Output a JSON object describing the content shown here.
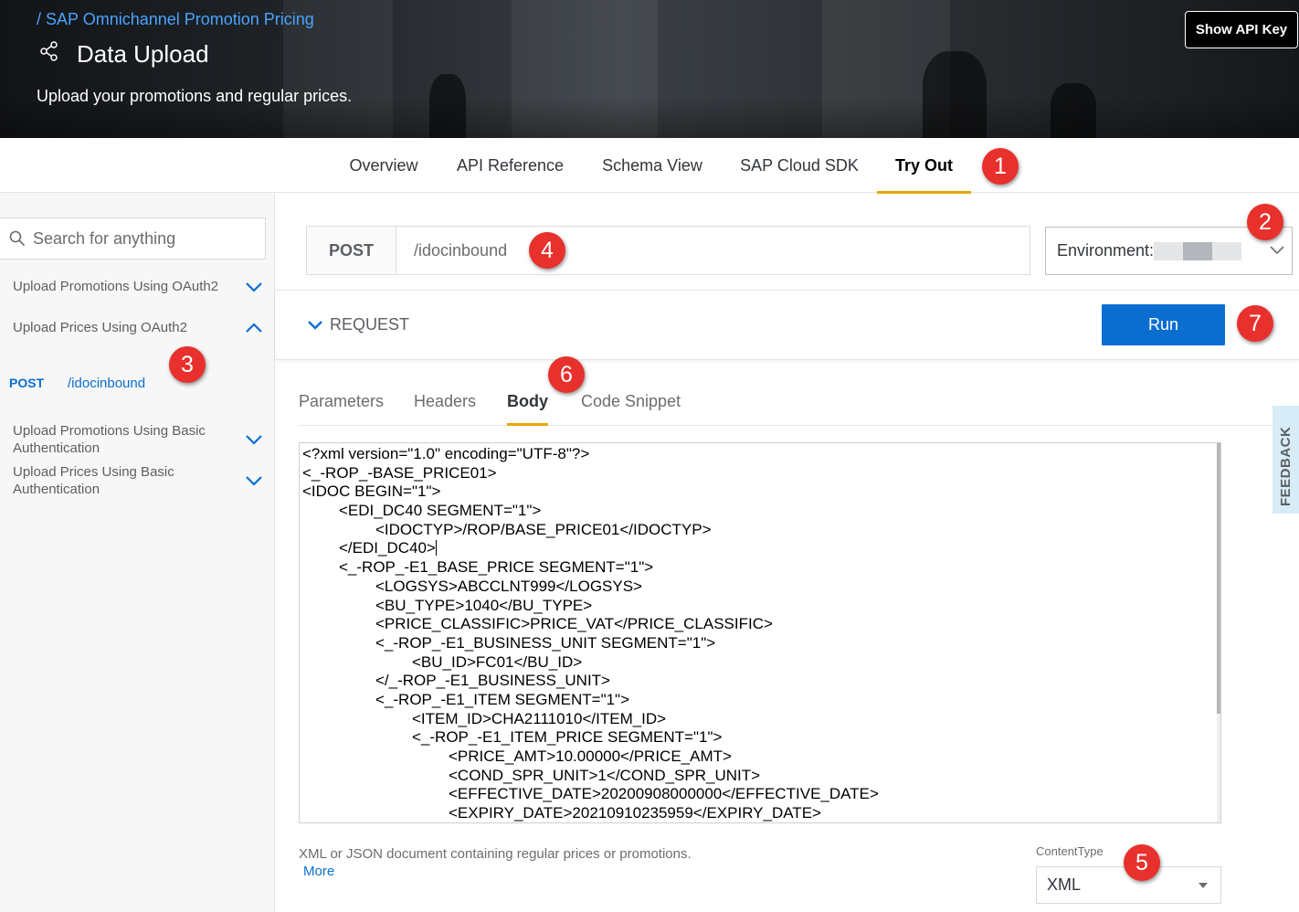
{
  "header": {
    "breadcrumb": "/ SAP Omnichannel Promotion Pricing",
    "title": "Data Upload",
    "subtitle": "Upload your promotions and regular prices.",
    "api_key_button": "Show API Key",
    "share_icon": "share-icon"
  },
  "tabs": [
    {
      "label": "Overview",
      "active": false
    },
    {
      "label": "API Reference",
      "active": false
    },
    {
      "label": "Schema View",
      "active": false
    },
    {
      "label": "SAP Cloud SDK",
      "active": false
    },
    {
      "label": "Try Out",
      "active": true
    }
  ],
  "badges": [
    "1",
    "2",
    "3",
    "4",
    "5",
    "6",
    "7"
  ],
  "sidebar": {
    "search_placeholder": "Search for anything",
    "items": [
      {
        "label": "Upload Promotions Using OAuth2",
        "expanded": false
      },
      {
        "label": "Upload Prices Using OAuth2",
        "expanded": true
      },
      {
        "label": "Upload Promotions Using Basic Authentication",
        "expanded": false
      },
      {
        "label": "Upload Prices Using Basic Authentication",
        "expanded": false
      }
    ],
    "sub_item": {
      "method": "POST",
      "path": "/idocinbound"
    }
  },
  "endpoint": {
    "method": "POST",
    "path": "/idocinbound"
  },
  "environment": {
    "label": "Environment:"
  },
  "request": {
    "label": "REQUEST",
    "run_label": "Run"
  },
  "subtabs": [
    {
      "label": "Parameters",
      "active": false
    },
    {
      "label": "Headers",
      "active": false
    },
    {
      "label": "Body",
      "active": true
    },
    {
      "label": "Code Snippet",
      "active": false
    }
  ],
  "body_lines": [
    "<?xml version=\"1.0\" encoding=\"UTF-8\"?>",
    "<_-ROP_-BASE_PRICE01>",
    "<IDOC BEGIN=\"1\">",
    "\t<EDI_DC40 SEGMENT=\"1\">",
    "\t\t<IDOCTYP>/ROP/BASE_PRICE01</IDOCTYP>",
    "\t</EDI_DC40>",
    "\t<_-ROP_-E1_BASE_PRICE SEGMENT=\"1\">",
    "\t\t<LOGSYS>ABCCLNT999</LOGSYS>",
    "\t\t<BU_TYPE>1040</BU_TYPE>",
    "\t\t<PRICE_CLASSIFIC>PRICE_VAT</PRICE_CLASSIFIC>",
    "\t\t<_-ROP_-E1_BUSINESS_UNIT SEGMENT=\"1\">",
    "\t\t\t<BU_ID>FC01</BU_ID>",
    "\t\t</_-ROP_-E1_BUSINESS_UNIT>",
    "\t\t<_-ROP_-E1_ITEM SEGMENT=\"1\">",
    "\t\t\t<ITEM_ID>CHA2111010</ITEM_ID>",
    "\t\t\t<_-ROP_-E1_ITEM_PRICE SEGMENT=\"1\">",
    "\t\t\t\t<PRICE_AMT>10.00000</PRICE_AMT>",
    "\t\t\t\t<COND_SPR_UNIT>1</COND_SPR_UNIT>",
    "\t\t\t\t<EFFECTIVE_DATE>20200908000000</EFFECTIVE_DATE>",
    "\t\t\t\t<EXPIRY_DATE>20210910235959</EXPIRY_DATE>"
  ],
  "body_description": "XML or JSON document containing regular prices or promotions.",
  "more_link": "More",
  "content_type": {
    "label": "ContentType",
    "value": "XML"
  },
  "feedback_label": "FEEDBACK",
  "colors": {
    "accent": "#0a6ed1",
    "tab_underline": "#e9a600",
    "badge": "#e8302c"
  }
}
